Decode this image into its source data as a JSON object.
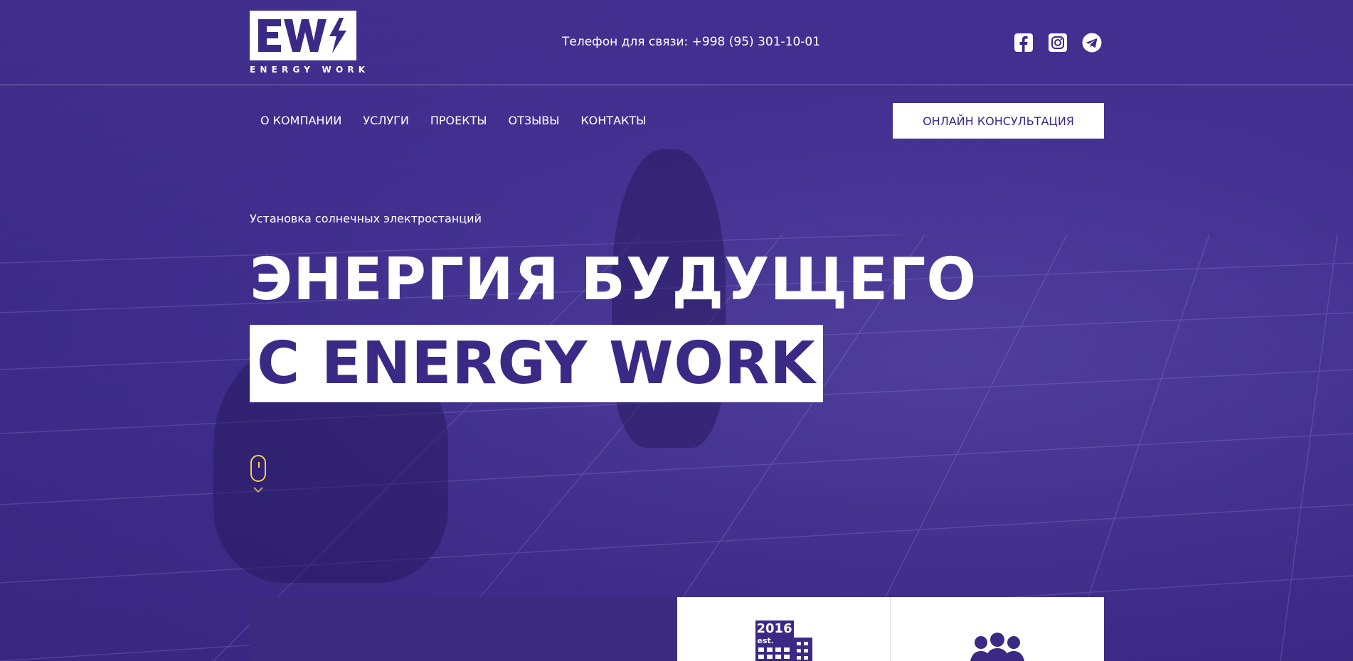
{
  "brand": {
    "logo_letters": "EW",
    "logo_tagline": "ENERGY WORK"
  },
  "header": {
    "phone_text": "Телефон для связи: +998 (95) 301-10-01",
    "socials": [
      {
        "name": "facebook-icon"
      },
      {
        "name": "instagram-icon"
      },
      {
        "name": "telegram-icon"
      }
    ]
  },
  "nav": {
    "items": [
      {
        "label": "О КОМПАНИИ"
      },
      {
        "label": "УСЛУГИ"
      },
      {
        "label": "ПРОЕКТЫ"
      },
      {
        "label": "ОТЗЫВЫ"
      },
      {
        "label": "КОНТАКТЫ"
      }
    ],
    "cta_label": "ОНЛАЙН КОНСУЛЬТАЦИЯ"
  },
  "hero": {
    "subtitle": "Установка солнечных электростанций",
    "title_line1": "ЭНЕРГИЯ БУДУЩЕГО",
    "title_line2": "С ENERGY WORK"
  },
  "cards": {
    "est_year": "2016",
    "est_label": "est."
  },
  "colors": {
    "primary": "#3b2a85",
    "accent": "#f1d24a",
    "white": "#ffffff"
  }
}
